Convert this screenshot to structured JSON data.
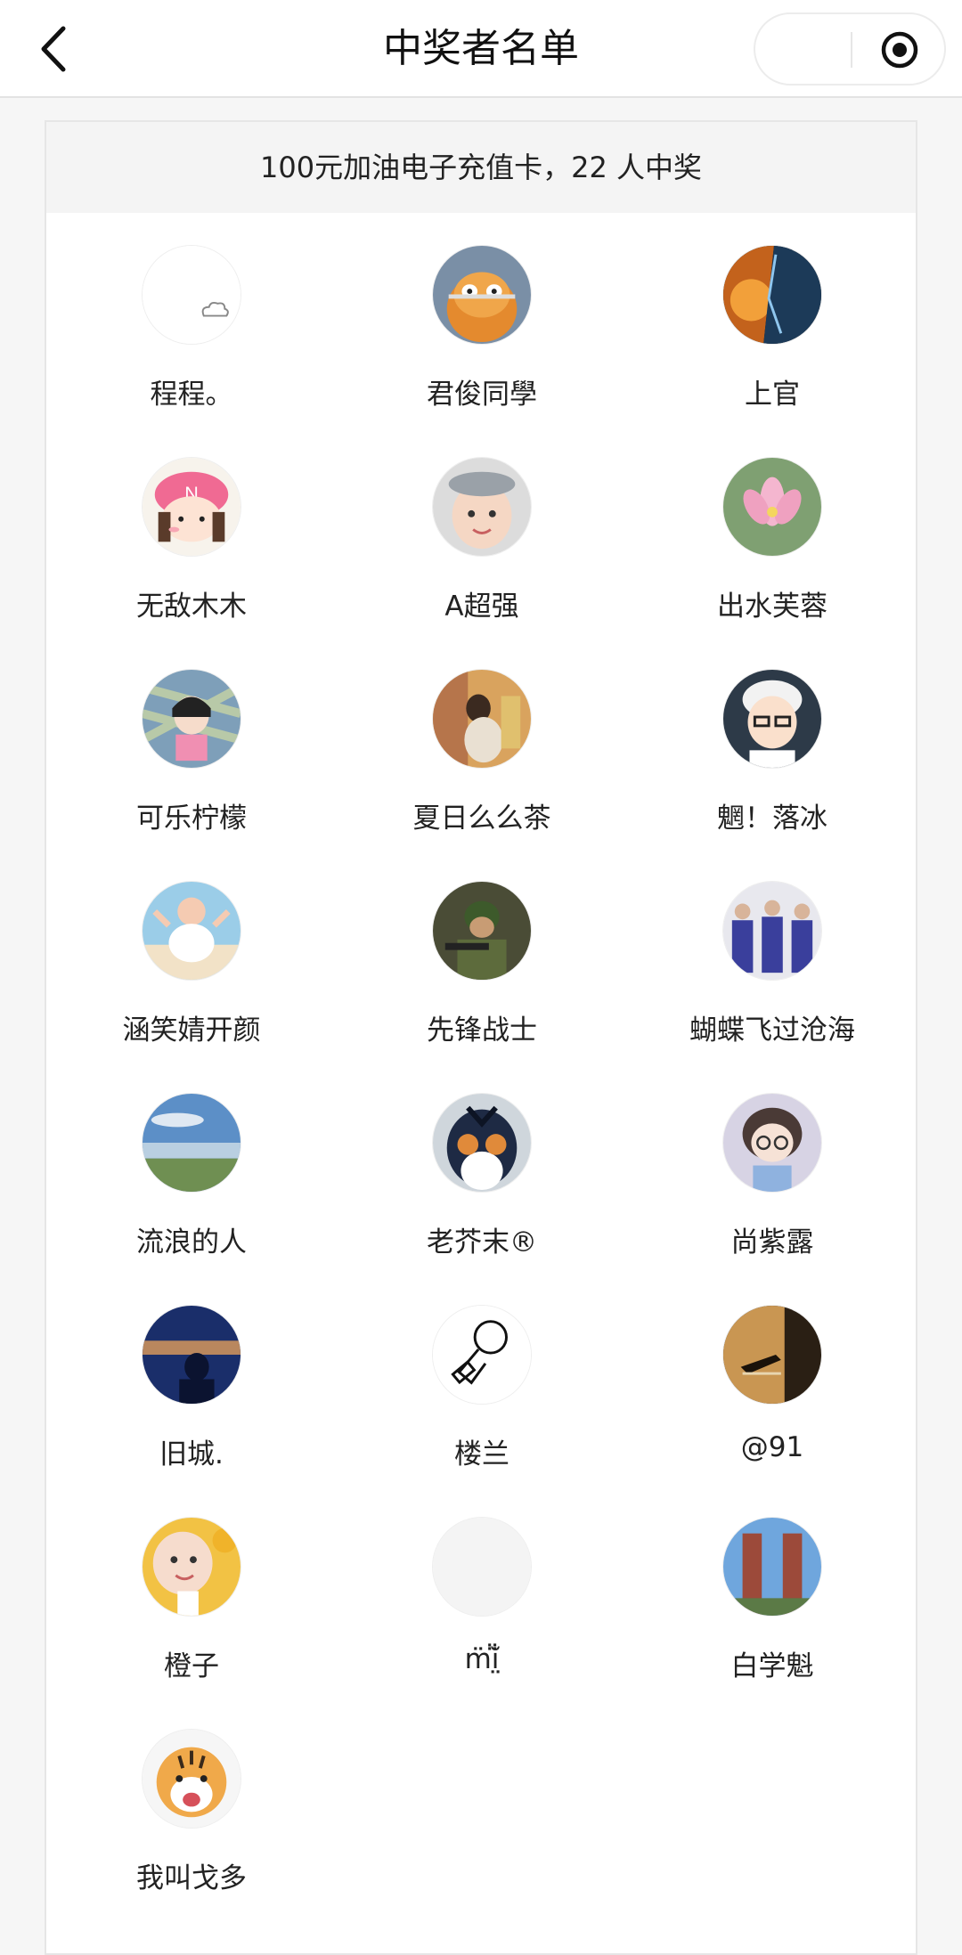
{
  "header": {
    "title": "中奖者名单",
    "back_icon": "chevron-left-icon",
    "capsule": {
      "more_icon": "more-icon",
      "close_icon": "target-circle-icon"
    }
  },
  "prize": {
    "summary": "100元加油电子充值卡，22 人中奖"
  },
  "winners": [
    {
      "name": "程程。",
      "avatar": "blank-cloud"
    },
    {
      "name": "君俊同學",
      "avatar": "orange-cat"
    },
    {
      "name": "上官",
      "avatar": "fire-ice-split"
    },
    {
      "name": "无敌木木",
      "avatar": "cartoon-girl-pink"
    },
    {
      "name": "A超强",
      "avatar": "baby-headband"
    },
    {
      "name": "出水芙蓉",
      "avatar": "lotus-flower"
    },
    {
      "name": "可乐柠檬",
      "avatar": "girl-money"
    },
    {
      "name": "夏日么么茶",
      "avatar": "woman-painting"
    },
    {
      "name": "魍！落冰",
      "avatar": "cartoon-man-glasses"
    },
    {
      "name": "涵笑婧开颜",
      "avatar": "dancing-girl-beach"
    },
    {
      "name": "先锋战士",
      "avatar": "soldier-camo"
    },
    {
      "name": "蝴蝶飞过沧海",
      "avatar": "group-blue-suits"
    },
    {
      "name": "流浪的人",
      "avatar": "lake-landscape"
    },
    {
      "name": "老芥末®",
      "avatar": "penguin-bird"
    },
    {
      "name": "尚紫露",
      "avatar": "doll-girl-glasses"
    },
    {
      "name": "旧城.",
      "avatar": "silhouette-dusk"
    },
    {
      "name": "楼兰",
      "avatar": "line-drawing-man"
    },
    {
      "name": "@91",
      "avatar": "hand-light"
    },
    {
      "name": "橙子",
      "avatar": "baby-flowers"
    },
    {
      "name": "m̈ĭ̤̈̈",
      "avatar": "blank-gray"
    },
    {
      "name": "白学魁",
      "avatar": "twin-towers"
    },
    {
      "name": "我叫戈多",
      "avatar": "tiger-cartoon"
    }
  ]
}
